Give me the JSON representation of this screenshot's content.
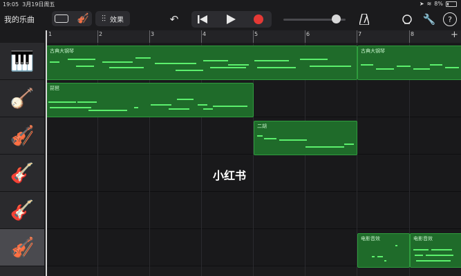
{
  "status": {
    "time": "19:05",
    "date": "3月19日周五",
    "battery": "8%"
  },
  "toolbar": {
    "my_songs": "我的乐曲",
    "effects_label": "效果",
    "metronome_icon": "metronome-icon",
    "help_label": "?"
  },
  "ruler": {
    "bars": [
      "1",
      "2",
      "3",
      "4",
      "5",
      "6",
      "7",
      "8"
    ],
    "add_label": "+"
  },
  "tracks": [
    {
      "name": "grand-piano",
      "icon": "piano-icon"
    },
    {
      "name": "pipa",
      "icon": "pipa-icon"
    },
    {
      "name": "erhu",
      "icon": "erhu-icon"
    },
    {
      "name": "bass",
      "icon": "bass-guitar-icon"
    },
    {
      "name": "acoustic-guitar",
      "icon": "acoustic-guitar-icon"
    },
    {
      "name": "strings",
      "icon": "strings-icon"
    }
  ],
  "regions": {
    "piano_a": "古典大钢琴",
    "piano_b": "古典大钢琴",
    "pipa": "琵琶",
    "erhu": "二胡",
    "fx_a": "电影音效",
    "fx_b": "电影音效"
  },
  "watermark": "小红书",
  "colors": {
    "region_fill": "#1f6b2a",
    "note": "#5cf06d",
    "record": "#e53935"
  }
}
